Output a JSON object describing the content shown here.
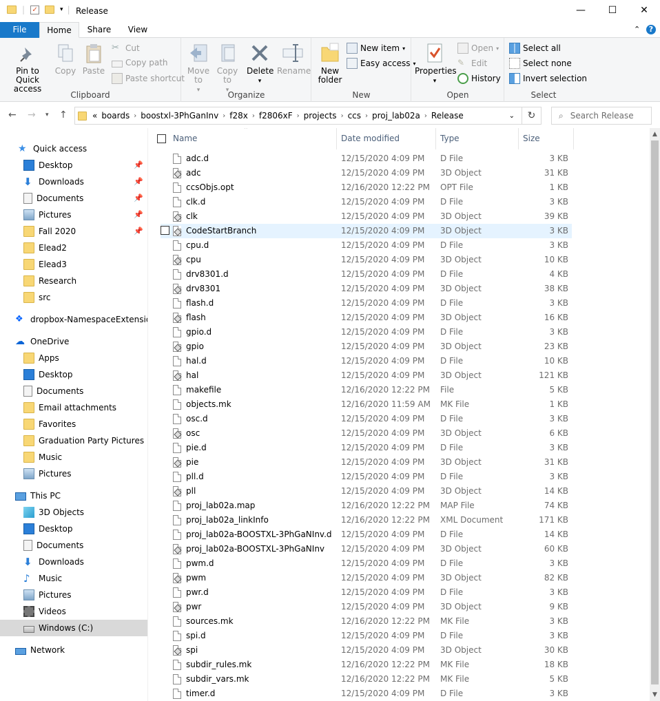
{
  "window": {
    "title": "Release",
    "minimize_glyph": "—",
    "maximize_glyph": "☐",
    "close_glyph": "✕"
  },
  "ribbon_tabs": [
    "File",
    "Home",
    "Share",
    "View"
  ],
  "ribbon": {
    "clipboard": {
      "label": "Clipboard",
      "pin_to_quick_access": "Pin to Quick access",
      "copy": "Copy",
      "paste": "Paste",
      "cut": "Cut",
      "copy_path": "Copy path",
      "paste_shortcut": "Paste shortcut"
    },
    "organize": {
      "label": "Organize",
      "move_to": "Move to",
      "copy_to": "Copy to",
      "delete": "Delete",
      "rename": "Rename"
    },
    "new": {
      "label": "New",
      "new_folder": "New folder",
      "new_item": "New item",
      "easy_access": "Easy access"
    },
    "open": {
      "label": "Open",
      "properties": "Properties",
      "open": "Open",
      "edit": "Edit",
      "history": "History"
    },
    "select": {
      "label": "Select",
      "select_all": "Select all",
      "select_none": "Select none",
      "invert_selection": "Invert selection"
    }
  },
  "address": {
    "breadcrumbs": [
      "boards",
      "boostxl-3PhGanInv",
      "f28x",
      "f2806xF",
      "projects",
      "ccs",
      "proj_lab02a",
      "Release"
    ],
    "overflow": "«",
    "search_placeholder": "Search Release"
  },
  "nav_pane": {
    "quick_access": "Quick access",
    "quick_items": [
      {
        "label": "Desktop",
        "icon": "desktop-icon",
        "pinned": true
      },
      {
        "label": "Downloads",
        "icon": "download-icon",
        "pinned": true
      },
      {
        "label": "Documents",
        "icon": "document-icon",
        "pinned": true
      },
      {
        "label": "Pictures",
        "icon": "pictures-icon",
        "pinned": true
      },
      {
        "label": "Fall 2020",
        "icon": "folder-icon",
        "pinned": true
      },
      {
        "label": "Elead2",
        "icon": "folder-icon",
        "pinned": false
      },
      {
        "label": "Elead3",
        "icon": "folder-icon",
        "pinned": false
      },
      {
        "label": "Research",
        "icon": "folder-icon",
        "pinned": false
      },
      {
        "label": "src",
        "icon": "folder-icon",
        "pinned": false
      }
    ],
    "dropbox": "dropbox-NamespaceExtensionF",
    "onedrive": "OneDrive",
    "onedrive_items": [
      "Apps",
      "Desktop",
      "Documents",
      "Email attachments",
      "Favorites",
      "Graduation Party Pictures",
      "Music",
      "Pictures"
    ],
    "this_pc": "This PC",
    "pc_items": [
      "3D Objects",
      "Desktop",
      "Documents",
      "Downloads",
      "Music",
      "Pictures",
      "Videos",
      "Windows (C:)"
    ],
    "network": "Network"
  },
  "columns": {
    "name": "Name",
    "date": "Date modified",
    "type": "Type",
    "size": "Size"
  },
  "files": [
    {
      "name": "adc.d",
      "date": "12/15/2020 4:09 PM",
      "type": "D File",
      "size": "3 KB",
      "obj": false
    },
    {
      "name": "adc",
      "date": "12/15/2020 4:09 PM",
      "type": "3D Object",
      "size": "31 KB",
      "obj": true
    },
    {
      "name": "ccsObjs.opt",
      "date": "12/16/2020 12:22 PM",
      "type": "OPT File",
      "size": "1 KB",
      "obj": false
    },
    {
      "name": "clk.d",
      "date": "12/15/2020 4:09 PM",
      "type": "D File",
      "size": "3 KB",
      "obj": false
    },
    {
      "name": "clk",
      "date": "12/15/2020 4:09 PM",
      "type": "3D Object",
      "size": "39 KB",
      "obj": true
    },
    {
      "name": "CodeStartBranch",
      "date": "12/15/2020 4:09 PM",
      "type": "3D Object",
      "size": "3 KB",
      "obj": true
    },
    {
      "name": "cpu.d",
      "date": "12/15/2020 4:09 PM",
      "type": "D File",
      "size": "3 KB",
      "obj": false
    },
    {
      "name": "cpu",
      "date": "12/15/2020 4:09 PM",
      "type": "3D Object",
      "size": "10 KB",
      "obj": true
    },
    {
      "name": "drv8301.d",
      "date": "12/15/2020 4:09 PM",
      "type": "D File",
      "size": "4 KB",
      "obj": false
    },
    {
      "name": "drv8301",
      "date": "12/15/2020 4:09 PM",
      "type": "3D Object",
      "size": "38 KB",
      "obj": true
    },
    {
      "name": "flash.d",
      "date": "12/15/2020 4:09 PM",
      "type": "D File",
      "size": "3 KB",
      "obj": false
    },
    {
      "name": "flash",
      "date": "12/15/2020 4:09 PM",
      "type": "3D Object",
      "size": "16 KB",
      "obj": true
    },
    {
      "name": "gpio.d",
      "date": "12/15/2020 4:09 PM",
      "type": "D File",
      "size": "3 KB",
      "obj": false
    },
    {
      "name": "gpio",
      "date": "12/15/2020 4:09 PM",
      "type": "3D Object",
      "size": "23 KB",
      "obj": true
    },
    {
      "name": "hal.d",
      "date": "12/15/2020 4:09 PM",
      "type": "D File",
      "size": "10 KB",
      "obj": false
    },
    {
      "name": "hal",
      "date": "12/15/2020 4:09 PM",
      "type": "3D Object",
      "size": "121 KB",
      "obj": true
    },
    {
      "name": "makefile",
      "date": "12/16/2020 12:22 PM",
      "type": "File",
      "size": "5 KB",
      "obj": false
    },
    {
      "name": "objects.mk",
      "date": "12/16/2020 11:59 AM",
      "type": "MK File",
      "size": "1 KB",
      "obj": false
    },
    {
      "name": "osc.d",
      "date": "12/15/2020 4:09 PM",
      "type": "D File",
      "size": "3 KB",
      "obj": false
    },
    {
      "name": "osc",
      "date": "12/15/2020 4:09 PM",
      "type": "3D Object",
      "size": "6 KB",
      "obj": true
    },
    {
      "name": "pie.d",
      "date": "12/15/2020 4:09 PM",
      "type": "D File",
      "size": "3 KB",
      "obj": false
    },
    {
      "name": "pie",
      "date": "12/15/2020 4:09 PM",
      "type": "3D Object",
      "size": "31 KB",
      "obj": true
    },
    {
      "name": "pll.d",
      "date": "12/15/2020 4:09 PM",
      "type": "D File",
      "size": "3 KB",
      "obj": false
    },
    {
      "name": "pll",
      "date": "12/15/2020 4:09 PM",
      "type": "3D Object",
      "size": "14 KB",
      "obj": true
    },
    {
      "name": "proj_lab02a.map",
      "date": "12/16/2020 12:22 PM",
      "type": "MAP File",
      "size": "74 KB",
      "obj": false
    },
    {
      "name": "proj_lab02a_linkInfo",
      "date": "12/16/2020 12:22 PM",
      "type": "XML Document",
      "size": "171 KB",
      "obj": false
    },
    {
      "name": "proj_lab02a-BOOSTXL-3PhGaNInv.d",
      "date": "12/15/2020 4:09 PM",
      "type": "D File",
      "size": "14 KB",
      "obj": false
    },
    {
      "name": "proj_lab02a-BOOSTXL-3PhGaNInv",
      "date": "12/15/2020 4:09 PM",
      "type": "3D Object",
      "size": "60 KB",
      "obj": true
    },
    {
      "name": "pwm.d",
      "date": "12/15/2020 4:09 PM",
      "type": "D File",
      "size": "3 KB",
      "obj": false
    },
    {
      "name": "pwm",
      "date": "12/15/2020 4:09 PM",
      "type": "3D Object",
      "size": "82 KB",
      "obj": true
    },
    {
      "name": "pwr.d",
      "date": "12/15/2020 4:09 PM",
      "type": "D File",
      "size": "3 KB",
      "obj": false
    },
    {
      "name": "pwr",
      "date": "12/15/2020 4:09 PM",
      "type": "3D Object",
      "size": "9 KB",
      "obj": true
    },
    {
      "name": "sources.mk",
      "date": "12/16/2020 12:22 PM",
      "type": "MK File",
      "size": "3 KB",
      "obj": false
    },
    {
      "name": "spi.d",
      "date": "12/15/2020 4:09 PM",
      "type": "D File",
      "size": "3 KB",
      "obj": false
    },
    {
      "name": "spi",
      "date": "12/15/2020 4:09 PM",
      "type": "3D Object",
      "size": "30 KB",
      "obj": true
    },
    {
      "name": "subdir_rules.mk",
      "date": "12/16/2020 12:22 PM",
      "type": "MK File",
      "size": "18 KB",
      "obj": false
    },
    {
      "name": "subdir_vars.mk",
      "date": "12/16/2020 12:22 PM",
      "type": "MK File",
      "size": "5 KB",
      "obj": false
    },
    {
      "name": "timer.d",
      "date": "12/15/2020 4:09 PM",
      "type": "D File",
      "size": "3 KB",
      "obj": false
    }
  ],
  "hovered_file": "CodeStartBranch",
  "colors": {
    "accent": "#1979ca",
    "selection": "#cce8ff",
    "hover": "#e5f3ff"
  }
}
